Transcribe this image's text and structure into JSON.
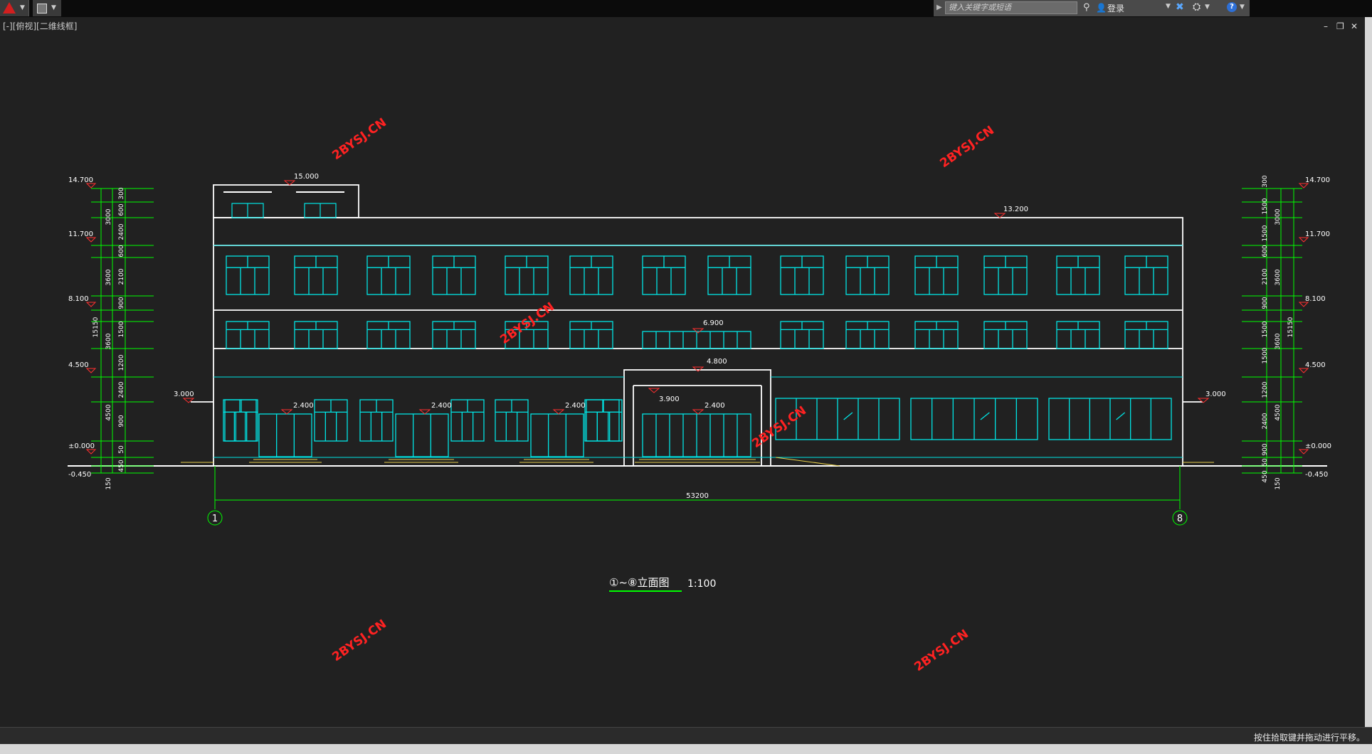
{
  "toolbar": {
    "search_placeholder": "键入关键字或短语",
    "login_label": "登录",
    "help_label": "?"
  },
  "viewport": {
    "label": "[-][俯视][二维线框]"
  },
  "window_controls": {
    "minimize": "–",
    "restore": "❐",
    "close": "✕"
  },
  "drawing": {
    "title": "①~⑧立面图",
    "scale": "1:100",
    "total_dimension": "53200",
    "axis_left": "1",
    "axis_right": "8",
    "watermark": "2BYSJ.CN",
    "elev_left": [
      "14.700",
      "11.700",
      "8.100",
      "4.500",
      "±0.000",
      "-0.450"
    ],
    "elev_right": [
      "14.700",
      "11.700",
      "8.100",
      "4.500",
      "±0.000",
      "-0.450"
    ],
    "dims_left_outer": [
      "300",
      "600",
      "2400",
      "600",
      "2100",
      "900",
      "1500",
      "1200",
      "2400",
      "900",
      "50",
      "450"
    ],
    "dims_left_mid": [
      "3000",
      "3600",
      "3600",
      "4500",
      "150"
    ],
    "dims_right_outer": [
      "300",
      "1500",
      "1500",
      "600",
      "2100",
      "900",
      "1500",
      "1500",
      "1200",
      "2400",
      "900",
      "50",
      "450"
    ],
    "dims_right_mid": [
      "3000",
      "3600",
      "3600",
      "4500",
      "150"
    ],
    "total_height_left": "15150",
    "total_height_right": "15150",
    "elevation_labels": {
      "roof_stair": "15.000",
      "roof_main": "13.200",
      "canopy_top": "6.900",
      "canopy": "4.800",
      "entry": "3.900",
      "door1": "2.400",
      "door2": "2.400",
      "door3": "2.400",
      "door4": "2.400",
      "side_left": "3.000",
      "side_right": "3.000"
    }
  },
  "status": {
    "message": "按住拾取键并拖动进行平移。"
  },
  "colors": {
    "background": "#212121",
    "building": "#ffffff",
    "windows": "#00e5e5",
    "dimensions": "#00ff00",
    "elev_marks": "#ff3030",
    "watermark": "#ff2222",
    "steps": "#e8d04a"
  }
}
